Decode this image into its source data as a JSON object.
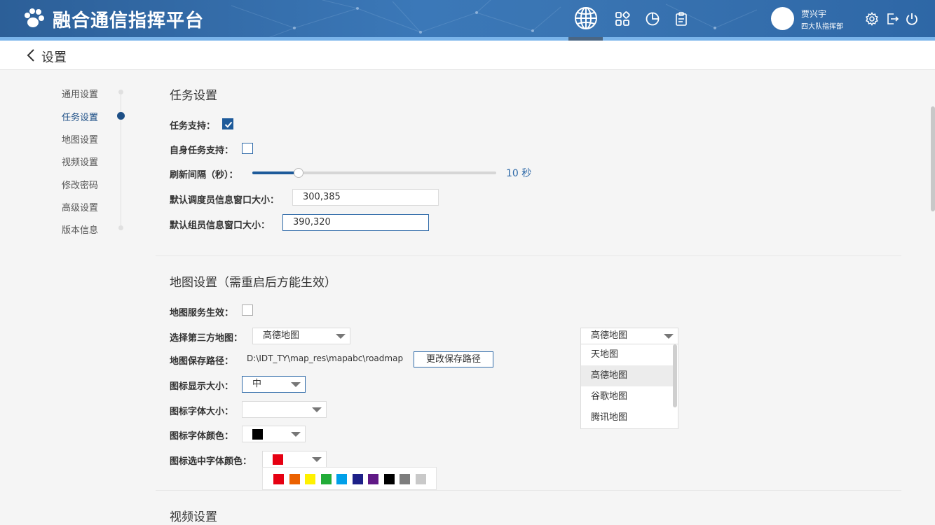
{
  "header": {
    "app_title": "融合通信指挥平台",
    "user_name": "贾兴宇",
    "user_dept": "四大队指挥部",
    "nav_icons": [
      "globe-icon",
      "apps-grid-icon",
      "pie-chart-icon",
      "clipboard-icon"
    ],
    "action_icons": [
      "gear-icon",
      "logout-icon",
      "power-icon"
    ]
  },
  "page": {
    "title": "设置"
  },
  "sidebar": {
    "items": [
      {
        "label": "通用设置"
      },
      {
        "label": "任务设置",
        "active": true
      },
      {
        "label": "地图设置"
      },
      {
        "label": "视频设置"
      },
      {
        "label": "修改密码"
      },
      {
        "label": "高级设置"
      },
      {
        "label": "版本信息"
      }
    ]
  },
  "task": {
    "title": "任务设置",
    "support_label": "任务支持：",
    "support_checked": true,
    "self_support_label": "自身任务支持：",
    "self_support_checked": false,
    "refresh_label": "刷新间隔（秒）：",
    "refresh_fraction": 0.19,
    "refresh_value": "10 秒",
    "dispatcher_window_label": "默认调度员信息窗口大小：",
    "dispatcher_window_value": "300,385",
    "member_window_label": "默认组员信息窗口大小：",
    "member_window_value": "390,320"
  },
  "map": {
    "title": "地图设置（需重启后方能生效）",
    "service_label": "地图服务生效：",
    "service_checked": false,
    "third_party_label": "选择第三方地图：",
    "third_party_value": "高德地图",
    "save_path_label": "地图保存路径：",
    "save_path_value": "D:\\IDT_TY\\map_res\\mapabc\\roadmap",
    "change_path_button": "更改保存路径",
    "icon_size_label": "图标显示大小：",
    "icon_size_value": "中",
    "icon_font_size_label": "图标字体大小：",
    "icon_font_size_value": "",
    "icon_font_color_label": "图标字体颜色：",
    "icon_font_color": "#000000",
    "icon_selected_color_label": "图标选中字体颜色：",
    "icon_selected_color": "#e60012",
    "palette": [
      "#e60012",
      "#eb6100",
      "#fff100",
      "#22ac38",
      "#00a0e9",
      "#1d2088",
      "#601986",
      "#000000",
      "#7d7d7d",
      "#c9c9c9"
    ]
  },
  "map_dropdown": {
    "value": "高德地图",
    "options": [
      "天地图",
      "高德地图",
      "谷歌地图",
      "腾讯地图"
    ],
    "highlighted": "高德地图"
  },
  "video": {
    "title": "视频设置"
  },
  "colors": {
    "header_blue": "#3b78b8",
    "accent": "#1d5a9a",
    "border_focus": "#2f6aa8"
  }
}
